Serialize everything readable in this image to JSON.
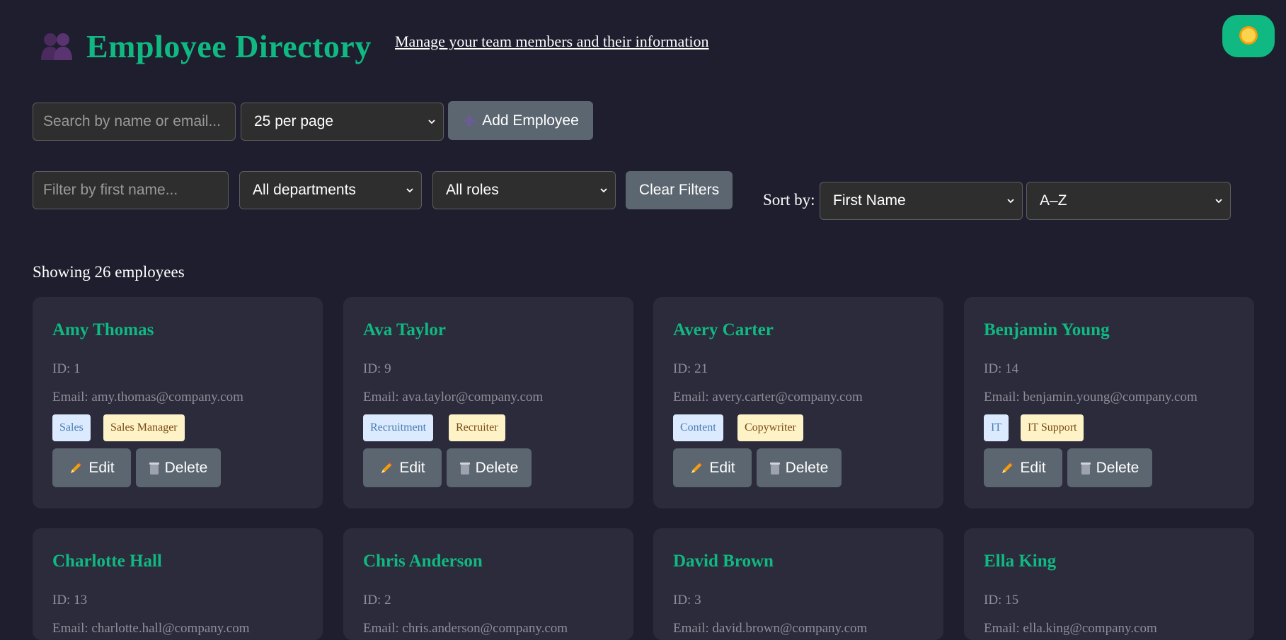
{
  "header": {
    "title": "Employee Directory",
    "subtitle": "Manage your team members and their information"
  },
  "toolbar": {
    "search_placeholder": "Search by name or email...",
    "per_page": "25 per page",
    "add_label": "Add Employee"
  },
  "filters": {
    "first_name_placeholder": "Filter by first name...",
    "department": "All departments",
    "role": "All roles",
    "clear_label": "Clear Filters",
    "sort_label": "Sort by:",
    "sort_field": "First Name",
    "sort_order": "A–Z"
  },
  "summary": "Showing 26 employees",
  "card_labels": {
    "edit": "Edit",
    "delete": "Delete"
  },
  "colors": {
    "accent": "#10b981",
    "background": "#1e1e2e",
    "card": "#2b2b3b",
    "button": "#5c6670"
  },
  "employees": [
    {
      "name": "Amy Thomas",
      "id": "ID: 1",
      "email": "Email: amy.thomas@company.com",
      "department": "Sales",
      "role": "Sales Manager"
    },
    {
      "name": "Ava Taylor",
      "id": "ID: 9",
      "email": "Email: ava.taylor@company.com",
      "department": "Recruitment",
      "role": "Recruiter"
    },
    {
      "name": "Avery Carter",
      "id": "ID: 21",
      "email": "Email: avery.carter@company.com",
      "department": "Content",
      "role": "Copywriter"
    },
    {
      "name": "Benjamin Young",
      "id": "ID: 14",
      "email": "Email: benjamin.young@company.com",
      "department": "IT",
      "role": "IT Support"
    },
    {
      "name": "Charlotte Hall",
      "id": "ID: 13",
      "email": "Email: charlotte.hall@company.com"
    },
    {
      "name": "Chris Anderson",
      "id": "ID: 2",
      "email": "Email: chris.anderson@company.com"
    },
    {
      "name": "David Brown",
      "id": "ID: 3",
      "email": "Email: david.brown@company.com"
    },
    {
      "name": "Ella King",
      "id": "ID: 15",
      "email": "Email: ella.king@company.com"
    }
  ]
}
